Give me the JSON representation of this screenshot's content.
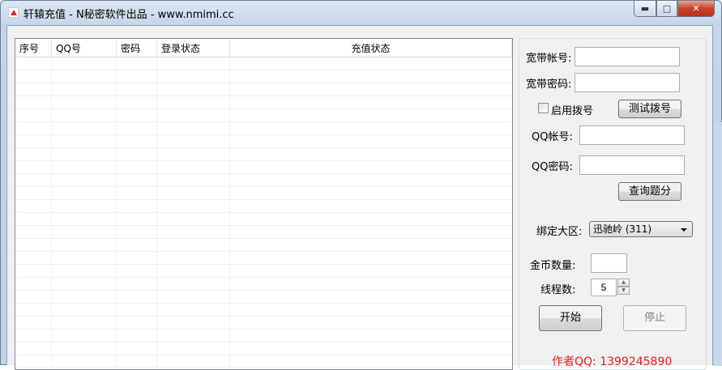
{
  "window": {
    "title": "轩辕充值 - N秘密软件出品 - www.nmimi.cc",
    "min": "▬",
    "max": "□",
    "close": "✕"
  },
  "list": {
    "columns": [
      "序号",
      "QQ号",
      "密码",
      "登录状态",
      "充值状态"
    ],
    "rows": []
  },
  "form": {
    "broadband_account_label": "宽带帐号:",
    "broadband_account": "",
    "broadband_password_label": "宽带密码:",
    "broadband_password": "",
    "enable_dial_label": "启用拨号",
    "enable_dial": false,
    "test_dial": "测试拨号",
    "qq_account_label": "QQ帐号:",
    "qq_account": "",
    "qq_password_label": "QQ密码:",
    "qq_password": "",
    "query_points": "查询题分",
    "server_label": "绑定大区:",
    "server_value": "迅驰岭 (311)",
    "coins_label": "金币数量:",
    "coins": "",
    "threads_label": "线程数:",
    "threads": "5",
    "start": "开始",
    "stop": "停止",
    "author": "作者QQ: 1399245890"
  }
}
